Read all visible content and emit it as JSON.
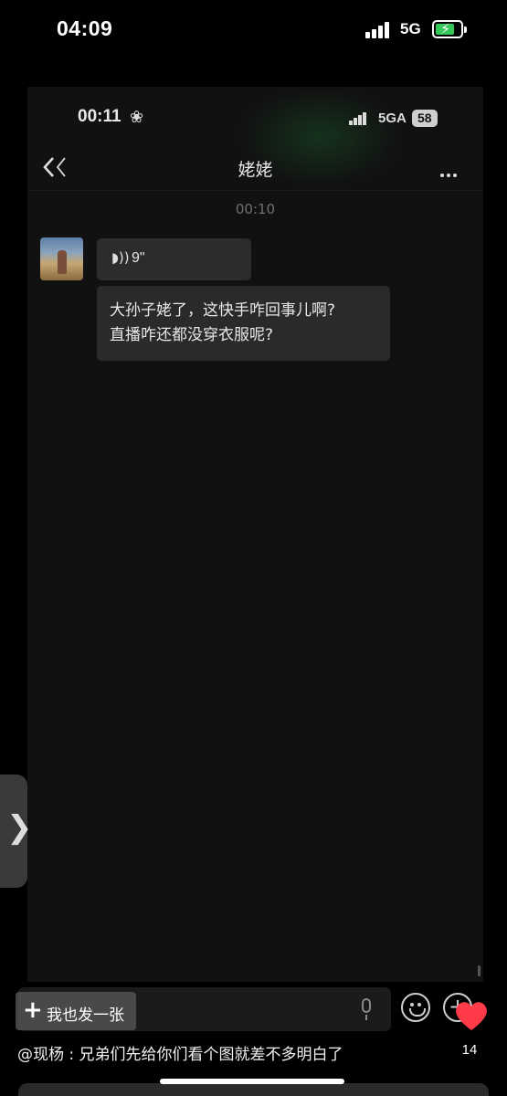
{
  "status_bar": {
    "time": "04:09",
    "network": "5G",
    "battery_charging": true,
    "battery_color": "#34c759"
  },
  "inner_screen": {
    "status_time": "00:11",
    "network": "5GA",
    "battery_level": "58",
    "chat": {
      "title": "姥姥",
      "timestamp": "00:10",
      "voice_message": {
        "duration": "9\""
      },
      "text_message_lines": [
        "大孙子姥了，这快手咋回事儿啊?",
        "直播咋还都没穿衣服呢?"
      ]
    }
  },
  "bottom": {
    "post_button_label": "我也发一张",
    "caption": "@现杨 : 兄弟们先给你们看个图就差不多明白了",
    "like_count": "14",
    "heart_color": "#ff3b4a"
  }
}
